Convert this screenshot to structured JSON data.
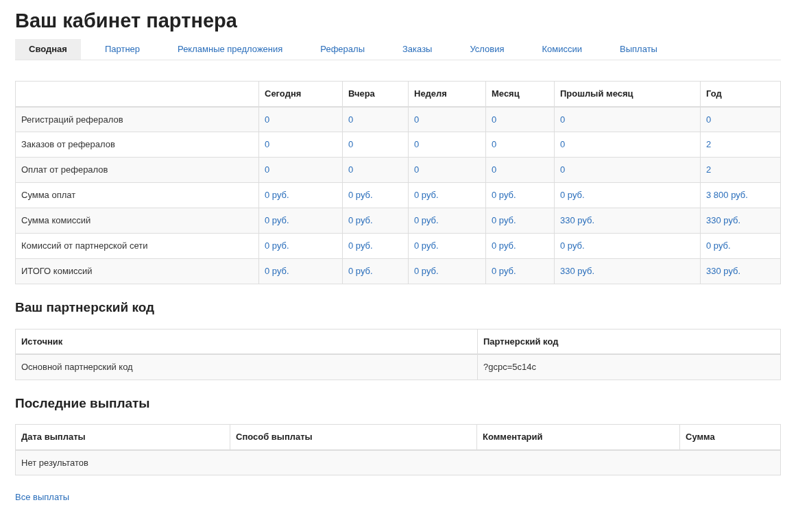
{
  "page_title": "Ваш кабинет партнера",
  "tabs": [
    {
      "label": "Сводная",
      "selected": true
    },
    {
      "label": "Партнер",
      "selected": false
    },
    {
      "label": "Рекламные предложения",
      "selected": false
    },
    {
      "label": "Рефералы",
      "selected": false
    },
    {
      "label": "Заказы",
      "selected": false
    },
    {
      "label": "Условия",
      "selected": false
    },
    {
      "label": "Комиссии",
      "selected": false
    },
    {
      "label": "Выплаты",
      "selected": false
    }
  ],
  "stats_table": {
    "columns": [
      "Сегодня",
      "Вчера",
      "Неделя",
      "Месяц",
      "Прошлый месяц",
      "Год"
    ],
    "rows": [
      {
        "label": "Регистраций рефералов",
        "values": [
          "0",
          "0",
          "0",
          "0",
          "0",
          "0"
        ]
      },
      {
        "label": "Заказов от рефералов",
        "values": [
          "0",
          "0",
          "0",
          "0",
          "0",
          "2"
        ]
      },
      {
        "label": "Оплат от рефералов",
        "values": [
          "0",
          "0",
          "0",
          "0",
          "0",
          "2"
        ]
      },
      {
        "label": "Сумма оплат",
        "values": [
          "0 руб.",
          "0 руб.",
          "0 руб.",
          "0 руб.",
          "0 руб.",
          "3 800 руб."
        ]
      },
      {
        "label": "Сумма комиссий",
        "values": [
          "0 руб.",
          "0 руб.",
          "0 руб.",
          "0 руб.",
          "330 руб.",
          "330 руб."
        ]
      },
      {
        "label": "Комиссий от партнерской сети",
        "values": [
          "0 руб.",
          "0 руб.",
          "0 руб.",
          "0 руб.",
          "0 руб.",
          "0 руб."
        ]
      },
      {
        "label": "ИТОГО комиссий",
        "values": [
          "0 руб.",
          "0 руб.",
          "0 руб.",
          "0 руб.",
          "330 руб.",
          "330 руб."
        ]
      }
    ]
  },
  "code_section": {
    "heading": "Ваш партнерский код",
    "columns": [
      "Источник",
      "Партнерский код"
    ],
    "rows": [
      [
        "Основной партнерский код",
        "?gcpc=5c14c"
      ]
    ]
  },
  "payouts_section": {
    "heading": "Последние выплаты",
    "columns": [
      "Дата выплаты",
      "Способ выплаты",
      "Комментарий",
      "Сумма"
    ],
    "empty_message": "Нет результатов",
    "link": "Все выплаты"
  }
}
